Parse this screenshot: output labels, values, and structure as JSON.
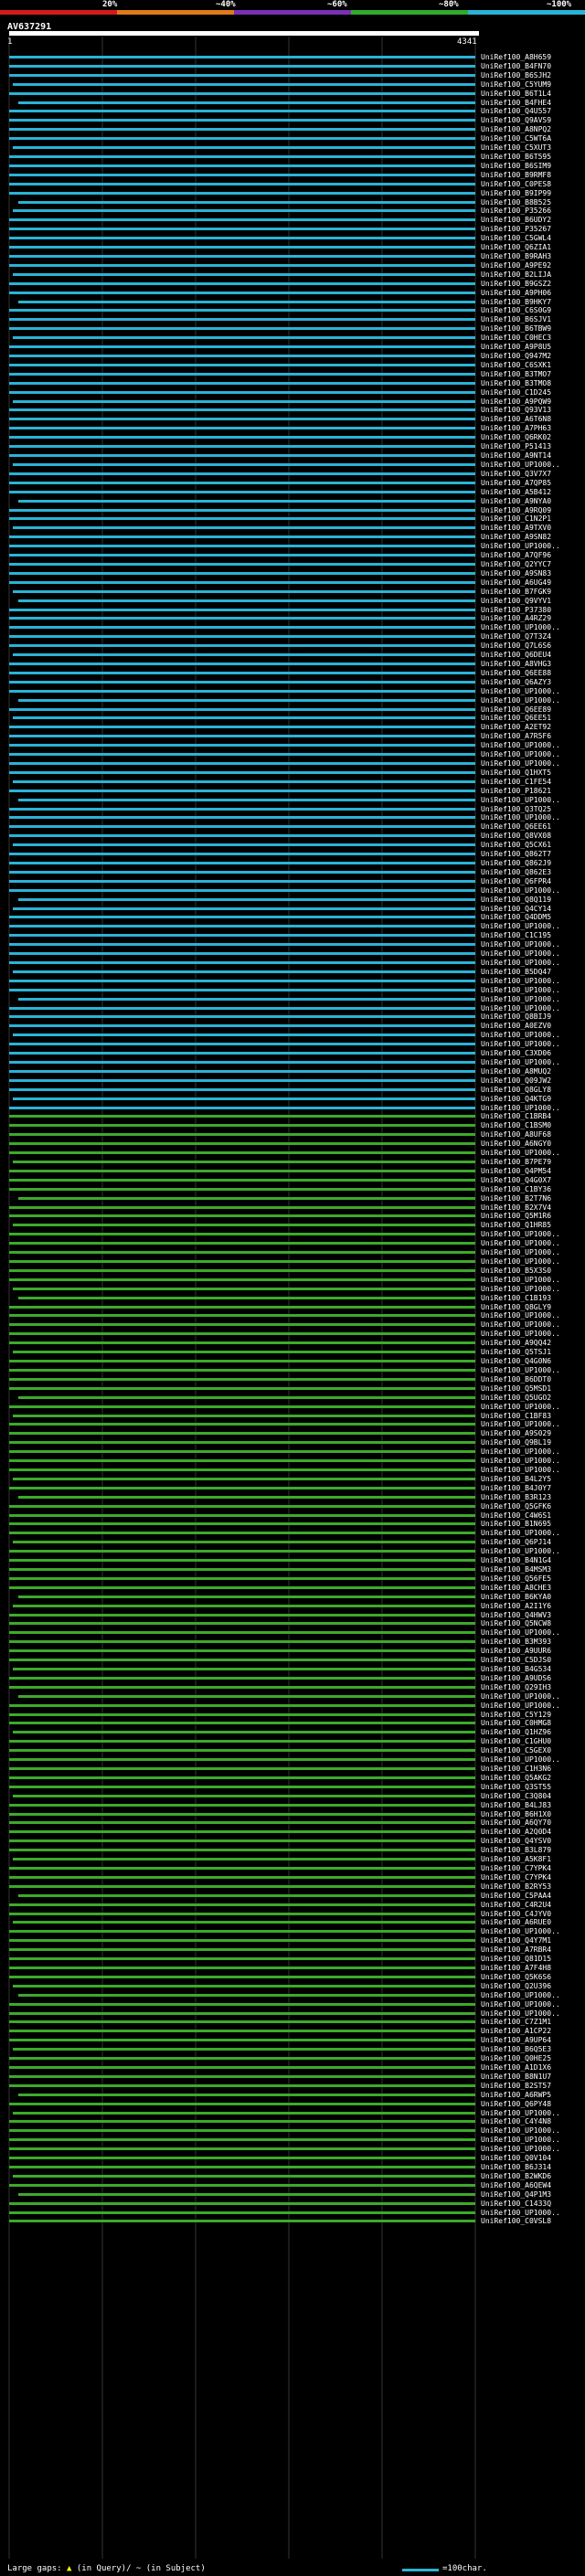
{
  "scale": {
    "ticks": [
      "20%",
      "~40%",
      "~60%",
      "~80%",
      "~100%"
    ],
    "band_colors": [
      "#d61a1a",
      "#e07a1a",
      "#7b2fb5",
      "#2faa2f",
      "#2ab3d6"
    ]
  },
  "query": {
    "id": "AV637291",
    "start": "1",
    "end": "4341"
  },
  "hit_colors": {
    "high": "#2ab3d6",
    "mid": "#3daa2a"
  },
  "hits": [
    "UniRef100_A8H659",
    "UniRef100_B4FN70",
    "UniRef100_B6SJH2",
    "UniRef100_C5YUM9",
    "UniRef100_B6T1L4",
    "UniRef100_B4FHE4",
    "UniRef100_Q4U557",
    "UniRef100_Q9AVS9",
    "UniRef100_A8NPQ2",
    "UniRef100_C5WT6A",
    "UniRef100_C5XUT3",
    "UniRef100_B6T595",
    "UniRef100_B6SIM9",
    "UniRef100_B9RMF8",
    "UniRef100_C0PES8",
    "UniRef100_B9IP99",
    "UniRef100_B8B525",
    "UniRef100_P35266",
    "UniRef100_B6UDY2",
    "UniRef100_P35267",
    "UniRef100_C5GWL4",
    "UniRef100_Q6ZIA1",
    "UniRef100_B9RAH3",
    "UniRef100_A9PE92",
    "UniRef100_B2LIJA",
    "UniRef100_B9GSZ2",
    "UniRef100_A9PH06",
    "UniRef100_B9HKY7",
    "UniRef100_C6S0G9",
    "UniRef100_B6SJV1",
    "UniRef100_B6TBW9",
    "UniRef100_C0HEC3",
    "UniRef100_A9P8U5",
    "UniRef100_Q947M2",
    "UniRef100_C6SXK1",
    "UniRef100_B3TMO7",
    "UniRef100_B3TMO8",
    "UniRef100_C1D245",
    "UniRef100_A9PQW9",
    "UniRef100_Q93V13",
    "UniRef100_A6T6N8",
    "UniRef100_A7PH63",
    "UniRef100_Q6RK02",
    "UniRef100_P51413",
    "UniRef100_A9NT14",
    "UniRef100_UP1000..",
    "UniRef100_Q3V7X7",
    "UniRef100_A7QP85",
    "UniRef100_A5B412",
    "UniRef100_A9NYA0",
    "UniRef100_A9RQ09",
    "UniRef100_C1N2P1",
    "UniRef100_A9TXV0",
    "UniRef100_A9SN82",
    "UniRef100_UP1000..",
    "UniRef100_A7QF96",
    "UniRef100_Q2YYC7",
    "UniRef100_A9SN83",
    "UniRef100_A6UG49",
    "UniRef100_B7FGK9",
    "UniRef100_Q9VYV1",
    "UniRef100_P37380",
    "UniRef100_A4RZ29",
    "UniRef100_UP1000..",
    "UniRef100_Q7T3Z4",
    "UniRef100_Q7L6S6",
    "UniRef100_Q6DEU4",
    "UniRef100_A8VHG3",
    "UniRef100_Q6EE88",
    "UniRef100_Q6AZY3",
    "UniRef100_UP1000..",
    "UniRef100_UP1000..",
    "UniRef100_Q6EE89",
    "UniRef100_Q6EE51",
    "UniRef100_A2ET92",
    "UniRef100_A7R5F6",
    "UniRef100_UP1000..",
    "UniRef100_UP1000..",
    "UniRef100_UP1000..",
    "UniRef100_Q1HXT5",
    "UniRef100_C1FE54",
    "UniRef100_P18621",
    "UniRef100_UP1000..",
    "UniRef100_Q3TQ25",
    "UniRef100_UP1000..",
    "UniRef100_Q6EE61",
    "UniRef100_Q8VX08",
    "UniRef100_Q5CX61",
    "UniRef100_Q862T7",
    "UniRef100_Q862J9",
    "UniRef100_Q862E3",
    "UniRef100_Q6FPR4",
    "UniRef100_UP1000..",
    "UniRef100_Q8Q119",
    "UniRef100_Q4CY14",
    "UniRef100_Q4DDM5",
    "UniRef100_UP1000..",
    "UniRef100_C1C195",
    "UniRef100_UP1000..",
    "UniRef100_UP1000..",
    "UniRef100_UP1000..",
    "UniRef100_B5DQ47",
    "UniRef100_UP1000..",
    "UniRef100_UP1000..",
    "UniRef100_UP1000..",
    "UniRef100_UP1000..",
    "UniRef100_Q8BIJ9",
    "UniRef100_A0EZV0",
    "UniRef100_UP1000..",
    "UniRef100_UP1000..",
    "UniRef100_C3XD06",
    "UniRef100_UP1000..",
    "UniRef100_A8MUQ2",
    "UniRef100_Q09JW2",
    "UniRef100_Q8GLY8",
    "UniRef100_Q4KTG9",
    "UniRef100_UP1000..",
    "UniRef100_C1BRB4",
    "UniRef100_C1BSM0",
    "UniRef100_A8UF68",
    "UniRef100_A6NGY0",
    "UniRef100_UP1000..",
    "UniRef100_B7PE79",
    "UniRef100_Q4PM54",
    "UniRef100_Q4G0X7",
    "UniRef100_C1BY36",
    "UniRef100_B2T7N6",
    "UniRef100_B2X7V4",
    "UniRef100_Q5M1R6",
    "UniRef100_Q1HR85",
    "UniRef100_UP1000..",
    "UniRef100_UP1000..",
    "UniRef100_UP1000..",
    "UniRef100_UP1000..",
    "UniRef100_B5X3S0",
    "UniRef100_UP1000..",
    "UniRef100_UP1000..",
    "UniRef100_C1B193",
    "UniRef100_Q8GLY9",
    "UniRef100_UP1000..",
    "UniRef100_UP1000..",
    "UniRef100_UP1000..",
    "UniRef100_A9QQ42",
    "UniRef100_Q5TSJ1",
    "UniRef100_Q4G0N6",
    "UniRef100_UP1000..",
    "UniRef100_B6DDT0",
    "UniRef100_Q5MSD1",
    "UniRef100_Q5UGO2",
    "UniRef100_UP1000..",
    "UniRef100_C1BF83",
    "UniRef100_UP1000..",
    "UniRef100_A9S029",
    "UniRef100_Q9BL19",
    "UniRef100_UP1000..",
    "UniRef100_UP1000..",
    "UniRef100_UP1000..",
    "UniRef100_B4L2Y5",
    "UniRef100_B4J0Y7",
    "UniRef100_B3R123",
    "UniRef100_Q5GFK6",
    "UniRef100_C4W6S1",
    "UniRef100_B1N695",
    "UniRef100_UP1000..",
    "UniRef100_Q6PJ14",
    "UniRef100_UP1000..",
    "UniRef100_B4N1G4",
    "UniRef100_B4MSM3",
    "UniRef100_Q56FE5",
    "UniRef100_A8CHE3",
    "UniRef100_B6KYA0",
    "UniRef100_A2I1Y6",
    "UniRef100_Q4HWV3",
    "UniRef100_Q5NCW8",
    "UniRef100_UP1000..",
    "UniRef100_B3M393",
    "UniRef100_A9UUR6",
    "UniRef100_C5DJS0",
    "UniRef100_B4G534",
    "UniRef100_A9UDS6",
    "UniRef100_Q29IH3",
    "UniRef100_UP1000..",
    "UniRef100_UP1000..",
    "UniRef100_C5Y129",
    "UniRef100_C0HMG8",
    "UniRef100_Q1HZ96",
    "UniRef100_C1GHU0",
    "UniRef100_C5GEX0",
    "UniRef100_UP1000..",
    "UniRef100_C1H3N6",
    "UniRef100_Q5AKG2",
    "UniRef100_Q3ST55",
    "UniRef100_C3Q804",
    "UniRef100_B4LJ83",
    "UniRef100_B6H1X0",
    "UniRef100_A6QY70",
    "UniRef100_A2Q0D4",
    "UniRef100_Q4YSV0",
    "UniRef100_B3L879",
    "UniRef100_A5K8F1",
    "UniRef100_C7YPK4",
    "UniRef100_C7YPK4",
    "UniRef100_B2RY53",
    "UniRef100_C5PAA4",
    "UniRef100_C4R2U4",
    "UniRef100_C4JYV0",
    "UniRef100_A6RUE0",
    "UniRef100_UP1000..",
    "UniRef100_Q4Y7M1",
    "UniRef100_A7RBR4",
    "UniRef100_Q81D15",
    "UniRef100_A7F4H8",
    "UniRef100_Q5K6S6",
    "UniRef100_Q2U396",
    "UniRef100_UP1000..",
    "UniRef100_UP1000..",
    "UniRef100_UP1000..",
    "UniRef100_C7Z1M1",
    "UniRef100_A1CP22",
    "UniRef100_A9UP64",
    "UniRef100_B6Q5E3",
    "UniRef100_Q0HE25",
    "UniRef100_A1D1X6",
    "UniRef100_B8N1U7",
    "UniRef100_B2ST57",
    "UniRef100_A6RWP5",
    "UniRef100_Q6PY48",
    "UniRef100_UP1000..",
    "UniRef100_C4Y4N8",
    "UniRef100_UP1000..",
    "UniRef100_UP1000..",
    "UniRef100_UP1000..",
    "UniRef100_Q0V104",
    "UniRef100_B6J314",
    "UniRef100_B2WKD6",
    "UniRef100_A6QEW4",
    "UniRef100_Q4P1M3",
    "UniRef100_C1433Q",
    "UniRef100_UP1000..",
    "UniRef100_C0VSL8"
  ],
  "footer": {
    "text": "Large gaps:",
    "query_gap": "(in Query)",
    "subject_gap": "(in Subject)",
    "legend": "=100char."
  }
}
